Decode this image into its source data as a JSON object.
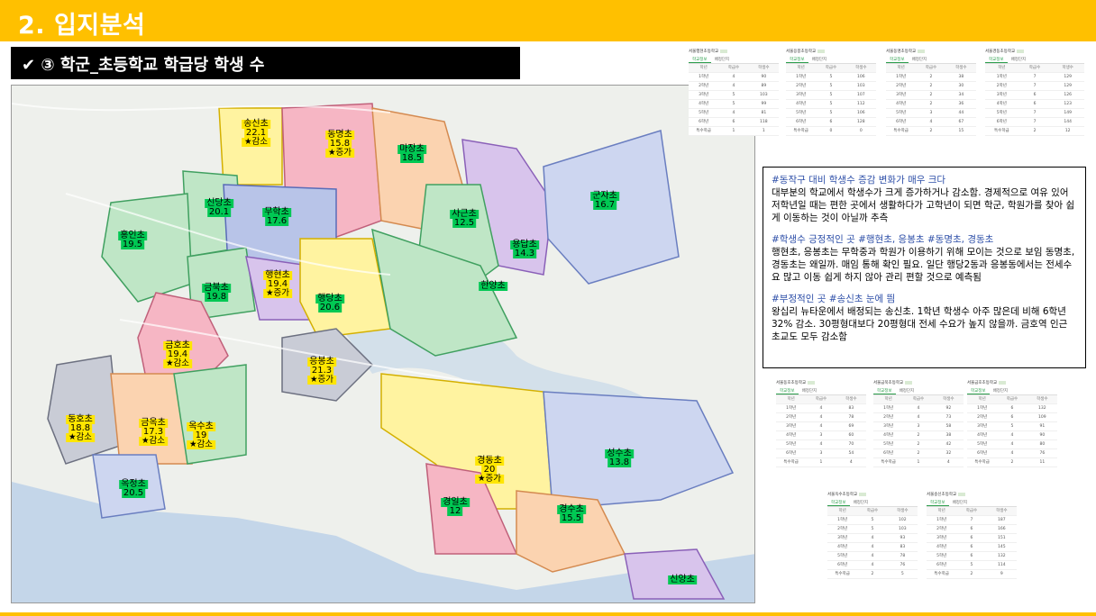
{
  "header": {
    "title": "2. 입지분석"
  },
  "subheader": {
    "title": "✔ ③ 학군_초등학교 학급당 학생 수"
  },
  "colors": {
    "accent": "#FFC000",
    "green_label": "#00C853",
    "yellow_label": "#FFE600",
    "note_heading": "#2E4FA8"
  },
  "map": {
    "schools": [
      {
        "name": "송신초",
        "value": "22.1",
        "change": "★감소",
        "hl": "yellow"
      },
      {
        "name": "동명초",
        "value": "15.8",
        "change": "★증가",
        "hl": "yellow"
      },
      {
        "name": "마장초",
        "value": "18.5",
        "change": "",
        "hl": "green"
      },
      {
        "name": "신당초",
        "value": "20.1",
        "change": "",
        "hl": "green"
      },
      {
        "name": "무학초",
        "value": "17.6",
        "change": "",
        "hl": "green"
      },
      {
        "name": "사근초",
        "value": "12.5",
        "change": "",
        "hl": "green"
      },
      {
        "name": "군자초",
        "value": "16.7",
        "change": "",
        "hl": "green"
      },
      {
        "name": "용답초",
        "value": "14.3",
        "change": "",
        "hl": "green"
      },
      {
        "name": "홍인초",
        "value": "19.5",
        "change": "",
        "hl": "green"
      },
      {
        "name": "금북초",
        "value": "19.8",
        "change": "",
        "hl": "green"
      },
      {
        "name": "행현초",
        "value": "19.4",
        "change": "★증가",
        "hl": "yellow"
      },
      {
        "name": "행당초",
        "value": "20.6",
        "change": "",
        "hl": "green"
      },
      {
        "name": "한양초",
        "value": "",
        "change": "",
        "hl": "green"
      },
      {
        "name": "금호초",
        "value": "19.4",
        "change": "★감소",
        "hl": "yellow"
      },
      {
        "name": "응봉초",
        "value": "21.3",
        "change": "★증가",
        "hl": "yellow"
      },
      {
        "name": "동호초",
        "value": "18.8",
        "change": "★감소",
        "hl": "yellow"
      },
      {
        "name": "금옥초",
        "value": "17.3",
        "change": "★감소",
        "hl": "yellow"
      },
      {
        "name": "옥수초",
        "value": "19",
        "change": "★감소",
        "hl": "yellow"
      },
      {
        "name": "경동초",
        "value": "20",
        "change": "★증가",
        "hl": "yellow"
      },
      {
        "name": "성수초",
        "value": "13.8",
        "change": "",
        "hl": "green"
      },
      {
        "name": "옥정초",
        "value": "20.5",
        "change": "",
        "hl": "green"
      },
      {
        "name": "경일초",
        "value": "12",
        "change": "",
        "hl": "green"
      },
      {
        "name": "경수초",
        "value": "15.5",
        "change": "",
        "hl": "green"
      },
      {
        "name": "신양초",
        "value": "",
        "change": "",
        "hl": "green"
      }
    ]
  },
  "note": {
    "p1_head": "#동작구 대비 학생수 증감 변화가 매우 크다",
    "p1_body": "대부분의 학교에서 학생수가 크게 증가하거나 감소함. 경제적으로 여유 있어 저학년일 때는 편한 곳에서 생활하다가 고학년이 되면 학군, 학원가를 찾아 쉽게 이동하는 것이 아닐까 추측",
    "p2_head": "#학생수 긍정적인 곳 #행현초, 응봉초 #동명초, 경동초",
    "p2_body": "행현초, 응봉초는 무학중과 학원가 이용하기 위해 모이는 것으로 보임 동명초, 경동초는 왜일까. 매임 통해 확인 필요. 일단 행당2동과 응봉동에서는 전세수요 많고 이동 쉽게 하지 않아 관리 편할 것으로 예측됨",
    "p3_head": "#부정적인 곳 #송신초 눈에 띔",
    "p3_body": "왕십리 뉴타운에서 배정되는 송신초. 1학년 학생수 아주 많은데 비해 6학년 32% 감소. 30평형대보다 20평형대 전세 수요가 높지 않을까. 금호역 인근 초교도 모두 감소함"
  },
  "tables": [
    {
      "name": "서울행현초등학교",
      "rows": [
        [
          "1학년",
          "4",
          "90"
        ],
        [
          "2학년",
          "4",
          "89"
        ],
        [
          "3학년",
          "5",
          "103"
        ],
        [
          "4학년",
          "5",
          "99"
        ],
        [
          "5학년",
          "4",
          "81"
        ],
        [
          "6학년",
          "6",
          "118"
        ],
        [
          "특수학급",
          "1",
          "1"
        ]
      ]
    },
    {
      "name": "서울응봉초등학교",
      "rows": [
        [
          "1학년",
          "5",
          "106"
        ],
        [
          "2학년",
          "5",
          "103"
        ],
        [
          "3학년",
          "5",
          "107"
        ],
        [
          "4학년",
          "5",
          "112"
        ],
        [
          "5학년",
          "5",
          "106"
        ],
        [
          "6학년",
          "6",
          "128"
        ],
        [
          "특수학급",
          "0",
          "0"
        ]
      ]
    },
    {
      "name": "서울동명초등학교",
      "rows": [
        [
          "1학년",
          "2",
          "38"
        ],
        [
          "2학년",
          "2",
          "30"
        ],
        [
          "3학년",
          "2",
          "34"
        ],
        [
          "4학년",
          "2",
          "36"
        ],
        [
          "5학년",
          "3",
          "44"
        ],
        [
          "6학년",
          "4",
          "67"
        ],
        [
          "특수학급",
          "2",
          "15"
        ]
      ]
    },
    {
      "name": "서울경동초등학교",
      "rows": [
        [
          "1학년",
          "7",
          "129"
        ],
        [
          "2학년",
          "7",
          "129"
        ],
        [
          "3학년",
          "6",
          "126"
        ],
        [
          "4학년",
          "6",
          "123"
        ],
        [
          "5학년",
          "7",
          "149"
        ],
        [
          "6학년",
          "7",
          "144"
        ],
        [
          "특수학급",
          "2",
          "12"
        ]
      ]
    },
    {
      "name": "서울동호초등학교",
      "rows": [
        [
          "1학년",
          "4",
          "83"
        ],
        [
          "2학년",
          "4",
          "78"
        ],
        [
          "3학년",
          "4",
          "69"
        ],
        [
          "4학년",
          "3",
          "60"
        ],
        [
          "5학년",
          "4",
          "70"
        ],
        [
          "6학년",
          "3",
          "54"
        ],
        [
          "특수학급",
          "1",
          "4"
        ]
      ]
    },
    {
      "name": "서울금북초등학교",
      "rows": [
        [
          "1학년",
          "4",
          "92"
        ],
        [
          "2학년",
          "4",
          "73"
        ],
        [
          "3학년",
          "3",
          "58"
        ],
        [
          "4학년",
          "2",
          "38"
        ],
        [
          "5학년",
          "2",
          "42"
        ],
        [
          "6학년",
          "2",
          "32"
        ],
        [
          "특수학급",
          "1",
          "4"
        ]
      ]
    },
    {
      "name": "서울금호초등학교",
      "rows": [
        [
          "1학년",
          "6",
          "132"
        ],
        [
          "2학년",
          "6",
          "109"
        ],
        [
          "3학년",
          "5",
          "91"
        ],
        [
          "4학년",
          "4",
          "90"
        ],
        [
          "5학년",
          "4",
          "80"
        ],
        [
          "6학년",
          "4",
          "76"
        ],
        [
          "특수학급",
          "2",
          "11"
        ]
      ]
    },
    {
      "name": "서울옥수초등학교",
      "rows": [
        [
          "1학년",
          "5",
          "102"
        ],
        [
          "2학년",
          "5",
          "103"
        ],
        [
          "3학년",
          "4",
          "93"
        ],
        [
          "4학년",
          "4",
          "83"
        ],
        [
          "5학년",
          "4",
          "78"
        ],
        [
          "6학년",
          "4",
          "76"
        ],
        [
          "특수학급",
          "2",
          "5"
        ]
      ]
    },
    {
      "name": "서울송신초등학교",
      "rows": [
        [
          "1학년",
          "7",
          "187"
        ],
        [
          "2학년",
          "6",
          "166"
        ],
        [
          "3학년",
          "6",
          "151"
        ],
        [
          "4학년",
          "6",
          "145"
        ],
        [
          "5학년",
          "6",
          "132"
        ],
        [
          "6학년",
          "5",
          "114"
        ],
        [
          "특수학급",
          "2",
          "9"
        ]
      ]
    }
  ],
  "table_common": {
    "tab1": "학교정보",
    "tab2": "배정단지",
    "h1": "학년",
    "h2": "학급수",
    "h3": "학생수"
  }
}
